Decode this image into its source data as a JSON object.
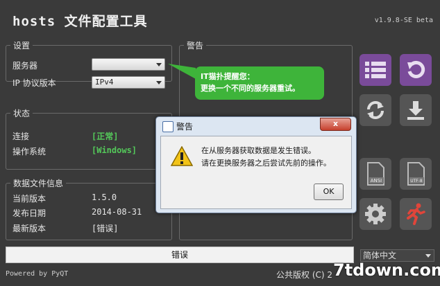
{
  "app": {
    "title": "hosts 文件配置工具",
    "version": "v1.9.8-SE beta"
  },
  "settings": {
    "legend": "设置",
    "server_label": "服务器",
    "server_value": "",
    "ip_label": "IP 协议版本",
    "ip_value": "IPv4"
  },
  "status": {
    "legend": "状态",
    "connection_label": "连接",
    "connection_value": "[正常]",
    "os_label": "操作系统",
    "os_value": "[Windows]"
  },
  "datafile": {
    "legend": "数据文件信息",
    "current_label": "当前版本",
    "current_value": "1.5.0",
    "date_label": "发布日期",
    "date_value": "2014-08-31",
    "latest_label": "最新版本",
    "latest_value": "[错误]"
  },
  "warning_panel": {
    "legend": "警告"
  },
  "tip": {
    "line1": "IT猫扑提醒您：",
    "line2": "更换一个不同的服务器重试。"
  },
  "dialog": {
    "title": "警告",
    "close_label": "x",
    "message_line1": "在从服务器获取数据是发生错误。",
    "message_line2": "请在更换服务器之后尝试先前的操作。",
    "ok_label": "OK"
  },
  "buttons": {
    "ansi_label": "ANSI",
    "utf8_label": "UTF-8"
  },
  "statusbar": {
    "text": "错误"
  },
  "footer": {
    "left": "Powered by PyQT",
    "right": "公共版权 (C) 2"
  },
  "language": {
    "selected": "简体中文"
  },
  "watermark": "7tdown.com",
  "colors": {
    "accent_purple": "#7a4b9a",
    "tip_green": "#3eb43a",
    "status_green": "#54c95a",
    "background": "#3a3a3a"
  }
}
